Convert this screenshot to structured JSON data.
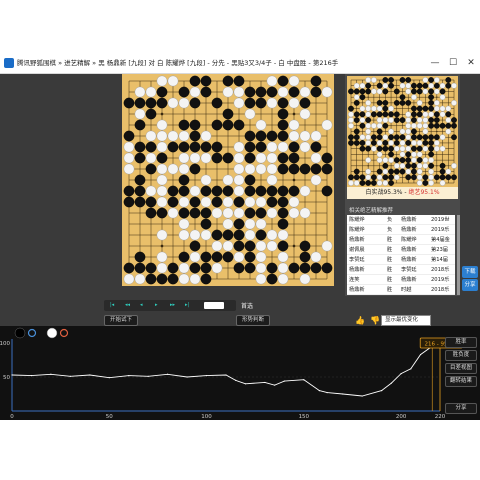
{
  "window": {
    "title": "腾讯野狐围棋 » 进艺精解 » 黑 杨鼎新 [九段] 对 白 陈耀烨 [九段] - 分先 - 黑贴3又3/4子 - 白 中盘胜 - 第216手",
    "minimize": "—",
    "maximize": "☐",
    "close": "✕"
  },
  "board": {
    "size": 19,
    "stones": [
      "...ww.bb.bb..wbw.b.",
      ".wwb.bwb.wwbbbwbwbw",
      "bbbbwwb.b.wbbwbwb..",
      ".wb......b.w..b.w..",
      ".b.w.bb.bbb.w.bw..w",
      "b.wwwwbw...bbbbwww.",
      "wbbwbbbbb.wbbwwbwb.",
      "wbwb.wwwbbwbwwbb.wb",
      "w.bwwwb...wwwwbbbbb",
      ".b.w.b.w.wwb.w...w.",
      "bbwwbbwbbbwbbbbbw.b",
      "bbbwbwbwbwbwwbbw...",
      "..bbwbbbwwwbbwbww..",
      ".....w.b.wbww.b....",
      "...w.wwwbbbwbww....",
      "......b.wwbbwwb.b.w",
      ".b.w.bwbbbwbw.w.bw.",
      "bbbwbwbbw.bbwbwbbbb",
      "wwbbbwwb....wbw.w.."
    ],
    "last_move_marker": "▲"
  },
  "side_panel": {
    "winrate_prefix": "白实战95.3% - ",
    "winrate_value": "绝艺95.1%",
    "reference_title": "相关绝艺精解推荐",
    "reference_games": [
      {
        "black": "陈耀烨",
        "result": "负",
        "white": "杨鼎新",
        "event": "2019世"
      },
      {
        "black": "陈耀烨",
        "result": "负",
        "white": "杨鼎新",
        "event": "2019乐"
      },
      {
        "black": "杨鼎新",
        "result": "胜",
        "white": "陈耀烨",
        "event": "第4届金"
      },
      {
        "black": "谢佩晨",
        "result": "胜",
        "white": "杨鼎新",
        "event": "第23届"
      },
      {
        "black": "李赞廷",
        "result": "胜",
        "white": "杨鼎新",
        "event": "第14届"
      },
      {
        "black": "杨鼎新",
        "result": "胜",
        "white": "李赞廷",
        "event": "2018乐"
      },
      {
        "black": "连笑",
        "result": "胜",
        "white": "杨鼎新",
        "event": "2019乐"
      },
      {
        "black": "杨鼎新",
        "result": "胜",
        "white": "时越",
        "event": "2018乐"
      }
    ],
    "side_button_1": "下载",
    "side_button_2": "分享"
  },
  "controls": {
    "transport_icons": [
      "|◂",
      "◂◂",
      "◂",
      "▸",
      "▸▸",
      "▸|"
    ],
    "move_field_value": "",
    "resign_label": "首选",
    "btn_try": "开始试下",
    "btn_judge": "形势判断",
    "like_icon": "👍",
    "dislike_icon": "👎",
    "variation_select": "显示最优变化"
  },
  "chart": {
    "players": [
      {
        "color": "#000000",
        "ring": "#4a90d9"
      },
      {
        "color": "#ffffff",
        "ring": "#e06040"
      }
    ],
    "tooltip": "216 - 95.3%",
    "buttons": [
      "胜率",
      "胜负度",
      "目差视图",
      "翻转结果"
    ],
    "bottom_button": "分享",
    "accent": "#e8a020"
  },
  "chart_data": {
    "type": "line",
    "title": "",
    "xlabel": "",
    "ylabel": "",
    "xlim": [
      0,
      220
    ],
    "ylim": [
      0,
      100
    ],
    "x_ticks": [
      0,
      50,
      100,
      150,
      200,
      220
    ],
    "y_ticks": [
      50,
      100
    ],
    "series": [
      {
        "name": "",
        "color": "#ffffff",
        "x": [
          0,
          10,
          20,
          30,
          40,
          50,
          60,
          70,
          80,
          90,
          100,
          110,
          115,
          120,
          130,
          135,
          140,
          150,
          158,
          162,
          170,
          180,
          190,
          195,
          200,
          205,
          210,
          216
        ],
        "y": [
          53,
          52,
          54,
          51,
          53,
          49,
          52,
          51,
          54,
          50,
          52,
          53,
          45,
          40,
          42,
          38,
          44,
          46,
          30,
          27,
          25,
          22,
          30,
          41,
          55,
          62,
          83,
          95.3
        ]
      }
    ]
  }
}
